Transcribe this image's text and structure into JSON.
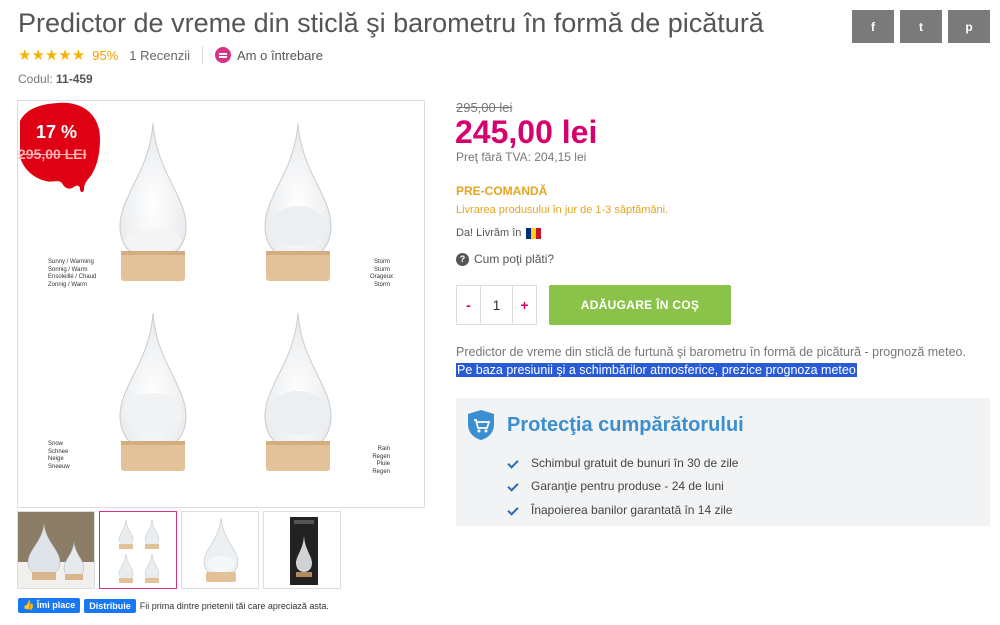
{
  "product": {
    "title": "Predictor de vreme din sticlă şi barometru în formă de picătură",
    "rating_stars": "★★★★★",
    "rating_pct": "95%",
    "reviews": "1 Recenzii",
    "ask": "Am o întrebare",
    "code_label": "Codul:",
    "code_value": "11-459"
  },
  "share": {
    "facebook": "f",
    "twitter": "t",
    "pinterest": "p"
  },
  "badge": {
    "discount": "17 %",
    "old_price": "295,00 LEI"
  },
  "image_labels": {
    "top_left": [
      "Sunny / Warming",
      "Sonnig / Warm",
      "Ensoleillé / Chaud",
      "Zonnig / Warm"
    ],
    "top_right": [
      "Storm",
      "Sturm",
      "Orageux",
      "Storm"
    ],
    "bottom_left": [
      "Snow",
      "Schnee",
      "Neige",
      "Sneeuw"
    ],
    "bottom_right": [
      "Rain",
      "Regen",
      "Pluie",
      "Regen"
    ]
  },
  "pricing": {
    "old_price": "295,00 lei",
    "price": "245,00 lei",
    "vat": "Preţ fără TVA: 204,15 lei",
    "status": "PRE-COMANDĂ",
    "delivery": "Livrarea produsului în jur de 1-3 săptămâni.",
    "ship": "Da! Livrăm în",
    "pay": "Cum poţi plăti?"
  },
  "cart": {
    "minus": "-",
    "qty": "1",
    "plus": "+",
    "add": "ADĂUGARE ÎN COŞ"
  },
  "description": {
    "line1": "Predictor de vreme din sticlă de furtună şi barometru în formă de picătură - prognoză meteo.",
    "line2": "Pe baza presiunii şi a schimbărilor atmosferice, prezice prognoza meteo"
  },
  "protection": {
    "title": "Protecţia cumpărătorului",
    "items": [
      "Schimbul gratuit de bunuri în 30 de zile",
      "Garanţie pentru produse - 24 de luni",
      "Înapoierea banilor garantată în 14 zile"
    ]
  },
  "facebook": {
    "like": "Îmi place",
    "share": "Distribuie",
    "text": "Fii prima dintre prietenii tăi care apreciază asta."
  },
  "colors": {
    "accent": "#d6006e",
    "cart": "#8bc34a",
    "precom": "#e6a521",
    "protect_title": "#3b8fd0"
  }
}
